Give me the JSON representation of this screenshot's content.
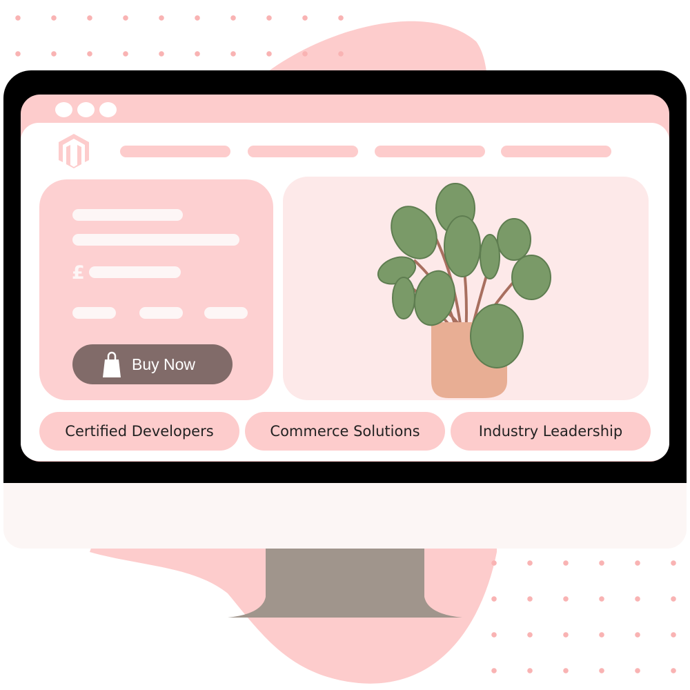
{
  "colors": {
    "accent": "#fdcccc",
    "button": "#816b69",
    "frame": "#000000",
    "leaf": "#7a9a68",
    "pot": "#e8ae94"
  },
  "product_card": {
    "currency_symbol": "£",
    "buy_label": "Buy Now",
    "buy_icon": "shopping-bag-icon"
  },
  "features": [
    {
      "label": "Certified Developers"
    },
    {
      "label": "Commerce Solutions"
    },
    {
      "label": "Industry Leadership"
    }
  ],
  "logo": "magento-logo"
}
